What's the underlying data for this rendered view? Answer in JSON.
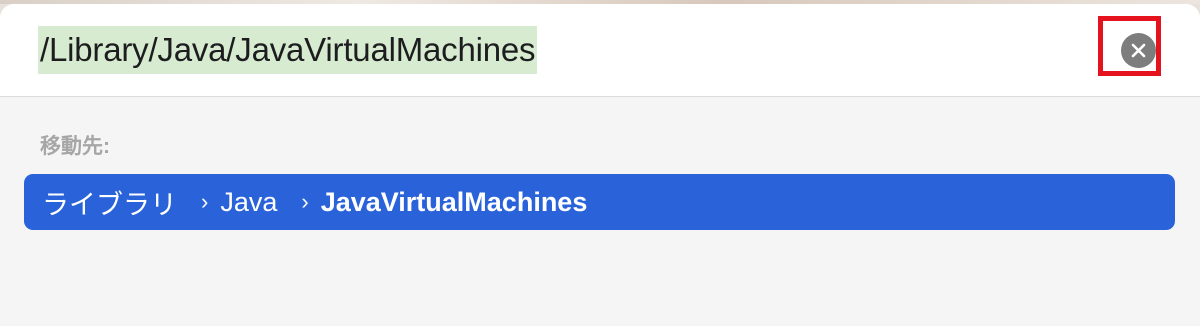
{
  "go_to_folder": {
    "path_value": "/Library/Java/JavaVirtualMachines",
    "clear_button_label": "✕",
    "section_label": "移動先:",
    "result": {
      "crumbs": [
        "ライブラリ",
        "Java",
        "JavaVirtualMachines"
      ],
      "separator": "›"
    }
  },
  "colors": {
    "selection_highlight": "#d6ebcf",
    "result_row_accent": "#2a63d9",
    "annotation_box": "#e5131d"
  },
  "icons": {
    "clear": "close-circle-icon",
    "breadcrumb_separator": "chevron-right-icon"
  }
}
